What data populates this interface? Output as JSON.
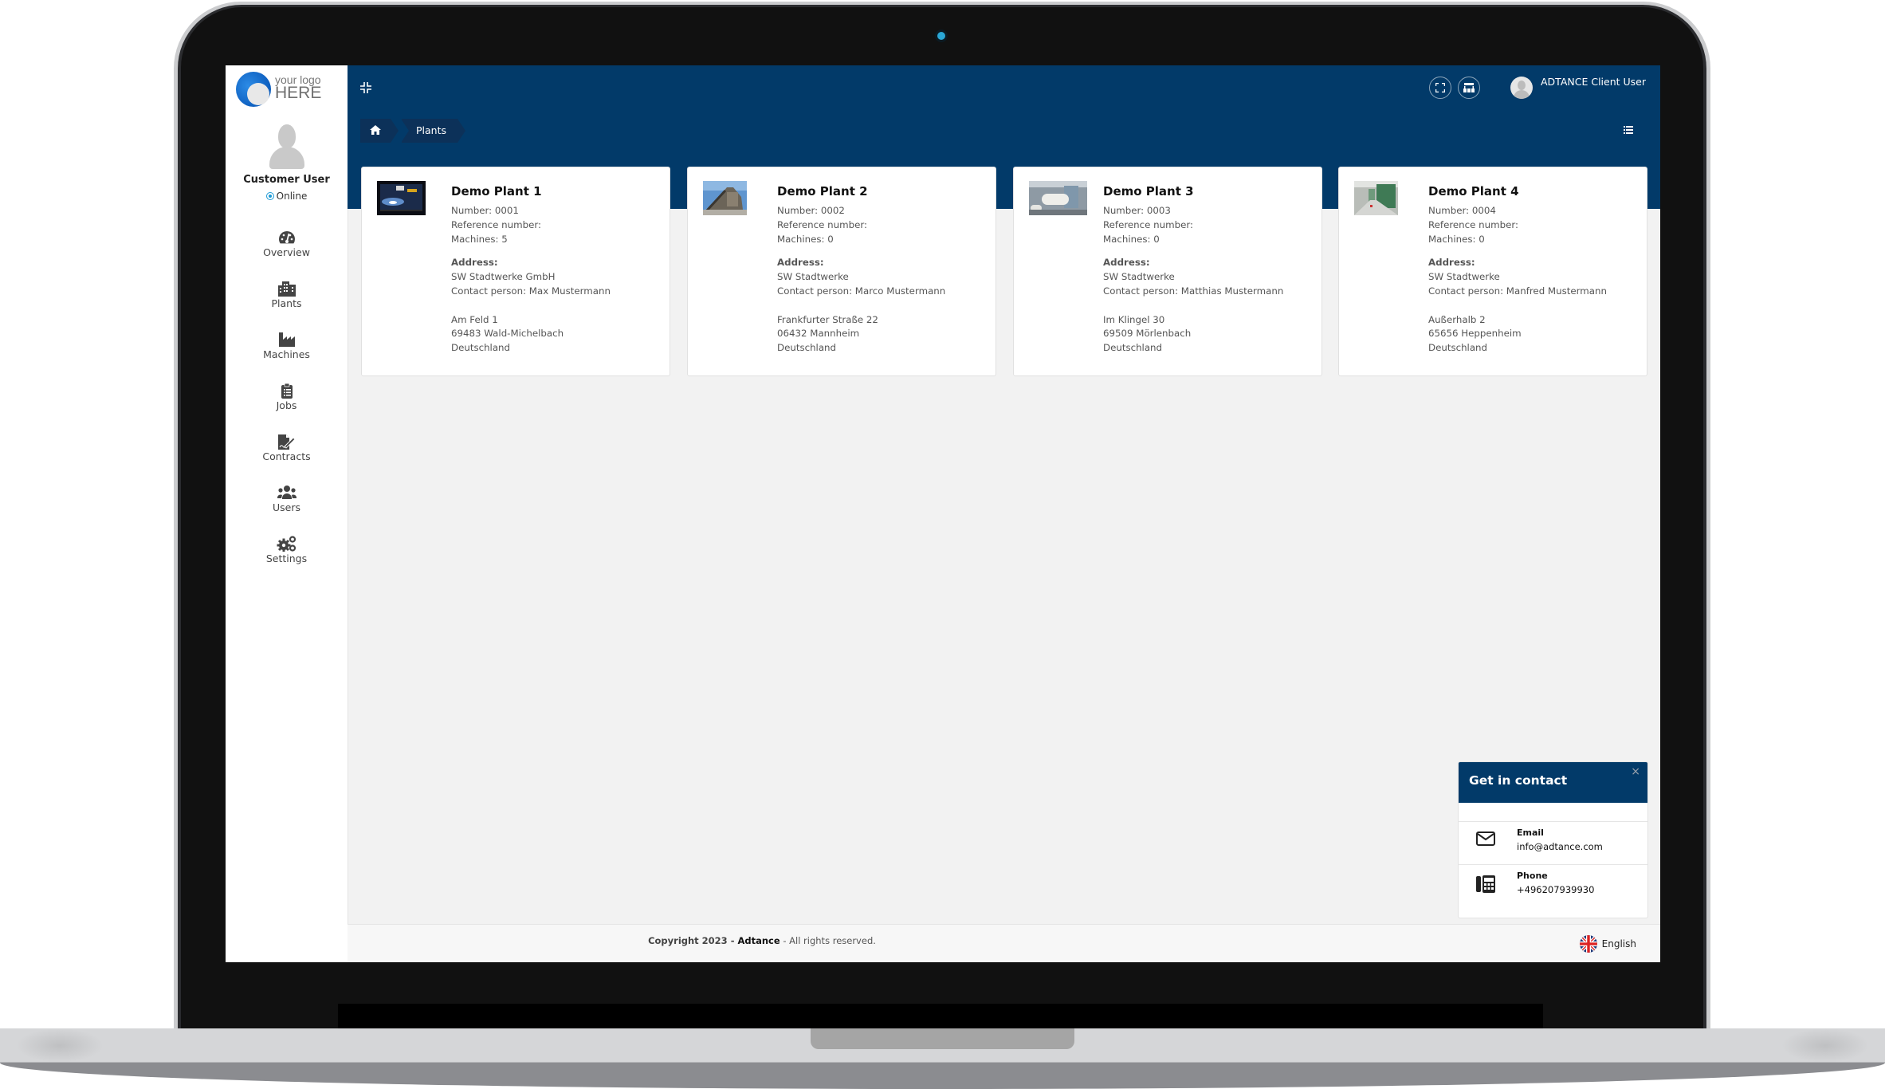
{
  "sidebar": {
    "logo": {
      "line1": "your logo",
      "line2": "HERE"
    },
    "profile": {
      "name": "Customer User",
      "status": "Online"
    },
    "items": [
      {
        "label": "Overview",
        "icon": "dashboard-gauge-icon"
      },
      {
        "label": "Plants",
        "icon": "building-icon"
      },
      {
        "label": "Machines",
        "icon": "industry-icon"
      },
      {
        "label": "Jobs",
        "icon": "clipboard-list-icon"
      },
      {
        "label": "Contracts",
        "icon": "file-signature-icon"
      },
      {
        "label": "Users",
        "icon": "users-icon"
      },
      {
        "label": "Settings",
        "icon": "cogs-icon"
      }
    ]
  },
  "header": {
    "collapse_icon": "compress-icon",
    "breadcrumb": [
      {
        "label": "",
        "icon": "home-icon"
      },
      {
        "label": "Plants"
      }
    ],
    "buttons": [
      {
        "icon": "fullscreen-icon"
      },
      {
        "icon": "sitemap-icon"
      }
    ],
    "user_name": "ADTANCE Client User",
    "view_toggle_icon": "list-icon"
  },
  "plants": [
    {
      "title": "Demo Plant 1",
      "number": "Number: 0001",
      "reference": "Reference number:",
      "machines": "Machines: 5",
      "address_label": "Address:",
      "company": "SW Stadtwerke GmbH",
      "contact": "Contact person: Max Mustermann",
      "street": "Am Feld 1",
      "city": "69483 Wald-Michelbach",
      "country": "Deutschland"
    },
    {
      "title": "Demo Plant 2",
      "number": "Number: 0002",
      "reference": "Reference number:",
      "machines": "Machines: 0",
      "address_label": "Address:",
      "company": "SW Stadtwerke",
      "contact": "Contact person: Marco Mustermann",
      "street": "Frankfurter Straße 22",
      "city": "06432 Mannheim",
      "country": "Deutschland"
    },
    {
      "title": "Demo Plant 3",
      "number": "Number: 0003",
      "reference": "Reference number:",
      "machines": "Machines: 0",
      "address_label": "Address:",
      "company": "SW Stadtwerke",
      "contact": "Contact person: Matthias Mustermann",
      "street": "Im Klingel 30",
      "city": "69509 Mörlenbach",
      "country": "Deutschland"
    },
    {
      "title": "Demo Plant 4",
      "number": "Number: 0004",
      "reference": "Reference number:",
      "machines": "Machines: 0",
      "address_label": "Address:",
      "company": "SW Stadtwerke",
      "contact": "Contact person: Manfred Mustermann",
      "street": "Außerhalb 2",
      "city": "65656 Heppenheim",
      "country": "Deutschland"
    }
  ],
  "contact_widget": {
    "title": "Get in contact",
    "close": "×",
    "email_label": "Email",
    "email_value": "info@adtance.com",
    "phone_label": "Phone",
    "phone_value": "+496207939930"
  },
  "footer": {
    "copyright_prefix": "Copyright 2023 - ",
    "brand": "Adtance",
    "copyright_suffix": " - All rights reserved.",
    "language": "English"
  },
  "colors": {
    "primary": "#023a69",
    "breadcrumb_bg": "#0c3159",
    "online": "#1b9ad6"
  }
}
